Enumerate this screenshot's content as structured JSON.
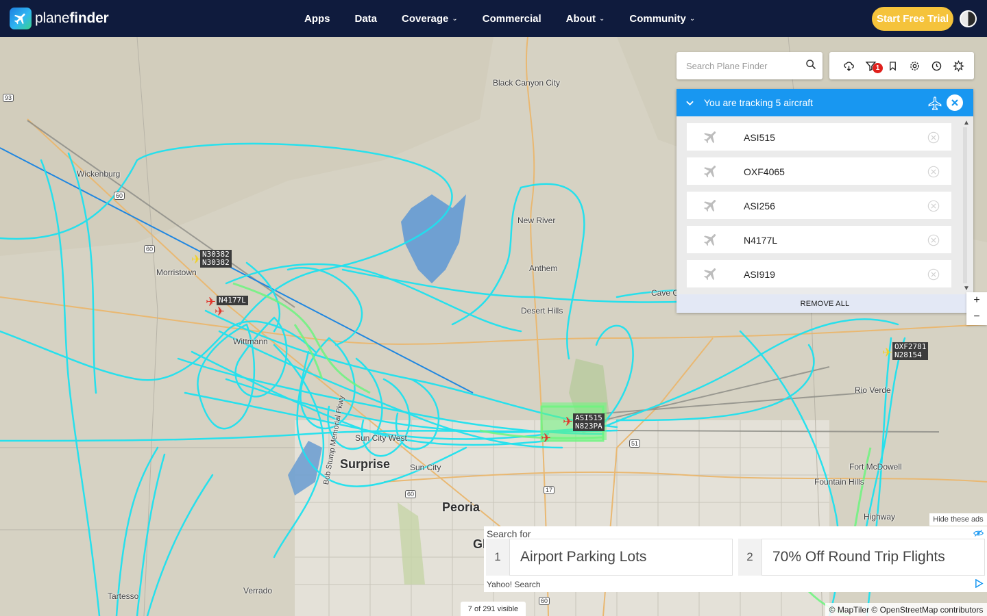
{
  "app": {
    "brand_light": "plane",
    "brand_bold": "finder",
    "accent": "#1897f1",
    "nav_bg": "#0f1b3d",
    "trial_color": "#f5c33b"
  },
  "nav": {
    "items": [
      {
        "label": "Apps",
        "dropdown": false
      },
      {
        "label": "Data",
        "dropdown": false
      },
      {
        "label": "Coverage",
        "dropdown": true
      },
      {
        "label": "Commercial",
        "dropdown": false
      },
      {
        "label": "About",
        "dropdown": true
      },
      {
        "label": "Community",
        "dropdown": true
      }
    ],
    "trial_label": "Start Free Trial"
  },
  "search": {
    "placeholder": "Search Plane Finder",
    "icon": "search-icon"
  },
  "toolbar": {
    "icons": [
      "weather-icon",
      "filter-icon",
      "bookmark-icon",
      "settings-icon",
      "history-icon",
      "layers-icon"
    ],
    "filter_badge": "1"
  },
  "tracking": {
    "header": "You are tracking 5 aircraft",
    "aircraft": [
      "ASI515",
      "OXF4065",
      "ASI256",
      "N4177L",
      "ASI919"
    ],
    "remove_all": "REMOVE ALL"
  },
  "map": {
    "places": [
      "Black Canyon City",
      "Wickenburg",
      "New River",
      "Anthem",
      "Morristown",
      "Desert Hills",
      "Cave Cr",
      "Wittmann",
      "Rio Verde",
      "Sun City West",
      "Surprise",
      "Sun City",
      "Peoria",
      "Fort McDowell",
      "Fountain Hills",
      "Verrado",
      "Tartesso",
      "Gl",
      "Bob Stump Memorial Pkwy",
      "Highway"
    ],
    "route_shields": [
      "93",
      "60",
      "60",
      "17",
      "51",
      "60",
      "60"
    ],
    "aircraft_tags": [
      {
        "line1": "N30382",
        "line2": "N30382"
      },
      {
        "line1": "N4177L",
        "line2": ""
      },
      {
        "line1": "ASI515",
        "line2": "N823PA"
      },
      {
        "line1": "OXF2781",
        "line2": "N28154"
      }
    ],
    "zoom_in": "+",
    "zoom_out": "−",
    "visible_count": "7 of 291 visible",
    "attribution": "© MapTiler © OpenStreetMap contributors"
  },
  "ad": {
    "hide_label": "Hide these ads",
    "search_for": "Search for",
    "options": [
      {
        "num": "1",
        "label": "Airport Parking Lots"
      },
      {
        "num": "2",
        "label": "70% Off Round Trip Flights"
      }
    ],
    "provider": "Yahoo! Search"
  }
}
